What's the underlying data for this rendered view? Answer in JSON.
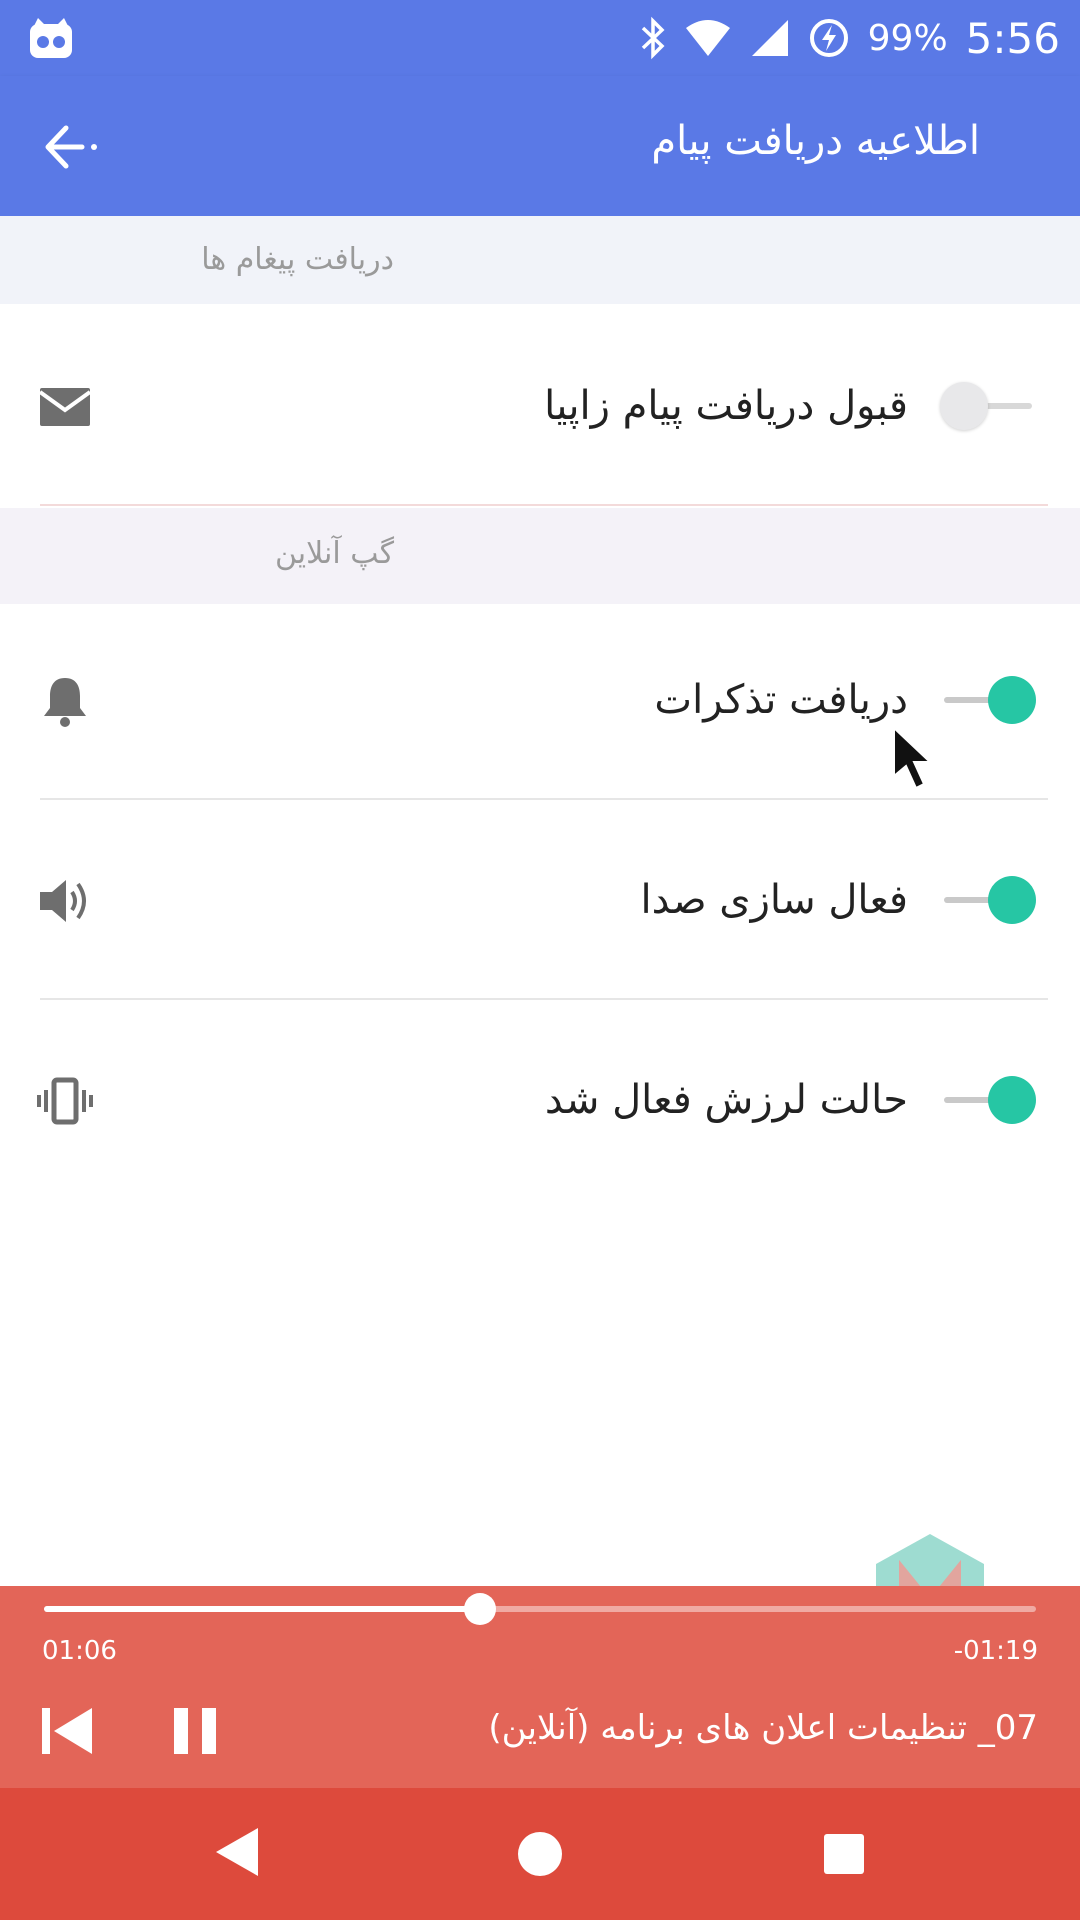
{
  "status_bar": {
    "battery": "99%",
    "time": "5:56",
    "icons": [
      "cyanogen-mod-icon",
      "bluetooth-icon",
      "wifi-icon",
      "cell-signal-icon",
      "battery-charging-icon"
    ]
  },
  "toolbar": {
    "title": "اطلاعیه دریافت پیام",
    "back_icon": "arrow-left-icon"
  },
  "sections": [
    {
      "title": "دریافت پیغام ها",
      "items": [
        {
          "label": "قبول دریافت پیام زاپیا",
          "icon": "envelope-icon",
          "enabled": false
        }
      ]
    },
    {
      "title": "گپ آنلاین",
      "items": [
        {
          "label": "دریافت تذکرات",
          "icon": "bell-icon",
          "enabled": true
        },
        {
          "label": "فعال سازی صدا",
          "icon": "speaker-icon",
          "enabled": true
        },
        {
          "label": "حالت لرزش فعال شد",
          "icon": "vibrate-icon",
          "enabled": true
        }
      ]
    }
  ],
  "player": {
    "elapsed": "01:06",
    "remaining": "-01:19",
    "progress": 0.44,
    "title": "07_ تنظیمات اعلان های برنامه (آنلاین)"
  },
  "colors": {
    "primary": "#5a79e6",
    "accent": "#26c6a4",
    "player_bg": "#e36558",
    "navbar_bg": "#dd4a3c",
    "switch_off_thumb": "#e8e8ea",
    "switch_off_track": "#d8d8d8"
  }
}
